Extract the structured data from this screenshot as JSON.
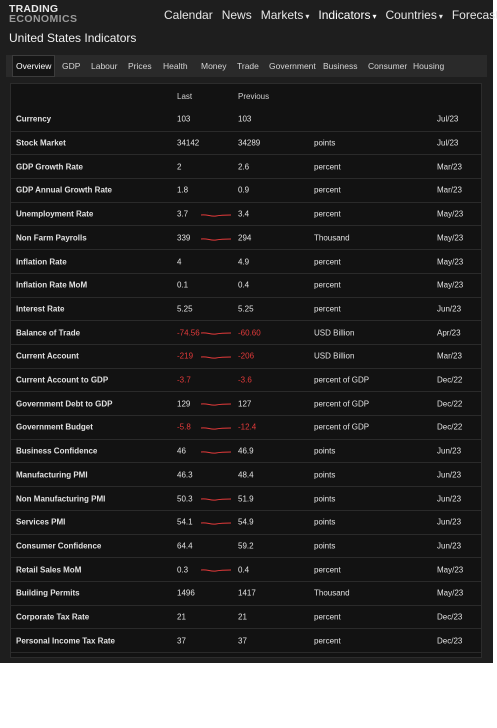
{
  "header": {
    "logo_line1": "TRADING",
    "logo_line2": "ECONOMICS",
    "nav": [
      {
        "label": "Calendar",
        "dropdown": false
      },
      {
        "label": "News",
        "dropdown": false
      },
      {
        "label": "Markets",
        "dropdown": true
      },
      {
        "label": "Indicators",
        "dropdown": true
      },
      {
        "label": "Countries",
        "dropdown": true
      },
      {
        "label": "Forecasts",
        "dropdown": true
      }
    ]
  },
  "page_title": "United States Indicators",
  "tabs": [
    "Overview",
    "GDP",
    "Labour",
    "Prices",
    "Health",
    "Money",
    "Trade",
    "Government",
    "Business",
    "Consumer",
    "Housing"
  ],
  "active_tab": "Overview",
  "table": {
    "columns": {
      "last": "Last",
      "previous": "Previous"
    },
    "rows": [
      {
        "name": "Currency",
        "last": "103",
        "previous": "103",
        "unit": "",
        "reference": "Jul/23",
        "spark": false,
        "negative": false
      },
      {
        "name": "Stock Market",
        "last": "34142",
        "previous": "34289",
        "unit": "points",
        "reference": "Jul/23",
        "spark": false,
        "negative": false
      },
      {
        "name": "GDP Growth Rate",
        "last": "2",
        "previous": "2.6",
        "unit": "percent",
        "reference": "Mar/23",
        "spark": false,
        "negative": false
      },
      {
        "name": "GDP Annual Growth Rate",
        "last": "1.8",
        "previous": "0.9",
        "unit": "percent",
        "reference": "Mar/23",
        "spark": false,
        "negative": false
      },
      {
        "name": "Unemployment Rate",
        "last": "3.7",
        "previous": "3.4",
        "unit": "percent",
        "reference": "May/23",
        "spark": true,
        "negative": false
      },
      {
        "name": "Non Farm Payrolls",
        "last": "339",
        "previous": "294",
        "unit": "Thousand",
        "reference": "May/23",
        "spark": true,
        "negative": false
      },
      {
        "name": "Inflation Rate",
        "last": "4",
        "previous": "4.9",
        "unit": "percent",
        "reference": "May/23",
        "spark": false,
        "negative": false
      },
      {
        "name": "Inflation Rate MoM",
        "last": "0.1",
        "previous": "0.4",
        "unit": "percent",
        "reference": "May/23",
        "spark": false,
        "negative": false
      },
      {
        "name": "Interest Rate",
        "last": "5.25",
        "previous": "5.25",
        "unit": "percent",
        "reference": "Jun/23",
        "spark": false,
        "negative": false
      },
      {
        "name": "Balance of Trade",
        "last": "-74.56",
        "previous": "-60.60",
        "unit": "USD Billion",
        "reference": "Apr/23",
        "spark": true,
        "negative": true
      },
      {
        "name": "Current Account",
        "last": "-219",
        "previous": "-206",
        "unit": "USD Billion",
        "reference": "Mar/23",
        "spark": true,
        "negative": true
      },
      {
        "name": "Current Account to GDP",
        "last": "-3.7",
        "previous": "-3.6",
        "unit": "percent of GDP",
        "reference": "Dec/22",
        "spark": false,
        "negative": true
      },
      {
        "name": "Government Debt to GDP",
        "last": "129",
        "previous": "127",
        "unit": "percent of GDP",
        "reference": "Dec/22",
        "spark": true,
        "negative": false
      },
      {
        "name": "Government Budget",
        "last": "-5.8",
        "previous": "-12.4",
        "unit": "percent of GDP",
        "reference": "Dec/22",
        "spark": true,
        "negative": true
      },
      {
        "name": "Business Confidence",
        "last": "46",
        "previous": "46.9",
        "unit": "points",
        "reference": "Jun/23",
        "spark": true,
        "negative": false
      },
      {
        "name": "Manufacturing PMI",
        "last": "46.3",
        "previous": "48.4",
        "unit": "points",
        "reference": "Jun/23",
        "spark": false,
        "negative": false
      },
      {
        "name": "Non Manufacturing PMI",
        "last": "50.3",
        "previous": "51.9",
        "unit": "points",
        "reference": "Jun/23",
        "spark": true,
        "negative": false
      },
      {
        "name": "Services PMI",
        "last": "54.1",
        "previous": "54.9",
        "unit": "points",
        "reference": "Jun/23",
        "spark": true,
        "negative": false
      },
      {
        "name": "Consumer Confidence",
        "last": "64.4",
        "previous": "59.2",
        "unit": "points",
        "reference": "Jun/23",
        "spark": false,
        "negative": false
      },
      {
        "name": "Retail Sales MoM",
        "last": "0.3",
        "previous": "0.4",
        "unit": "percent",
        "reference": "May/23",
        "spark": true,
        "negative": false
      },
      {
        "name": "Building Permits",
        "last": "1496",
        "previous": "1417",
        "unit": "Thousand",
        "reference": "May/23",
        "spark": false,
        "negative": false
      },
      {
        "name": "Corporate Tax Rate",
        "last": "21",
        "previous": "21",
        "unit": "percent",
        "reference": "Dec/23",
        "spark": false,
        "negative": false
      },
      {
        "name": "Personal Income Tax Rate",
        "last": "37",
        "previous": "37",
        "unit": "percent",
        "reference": "Dec/23",
        "spark": false,
        "negative": false
      }
    ]
  },
  "colors": {
    "background": "#1e1e1e",
    "panel": "#121212",
    "negative": "#e23a3a",
    "text": "#e2e2e2"
  }
}
